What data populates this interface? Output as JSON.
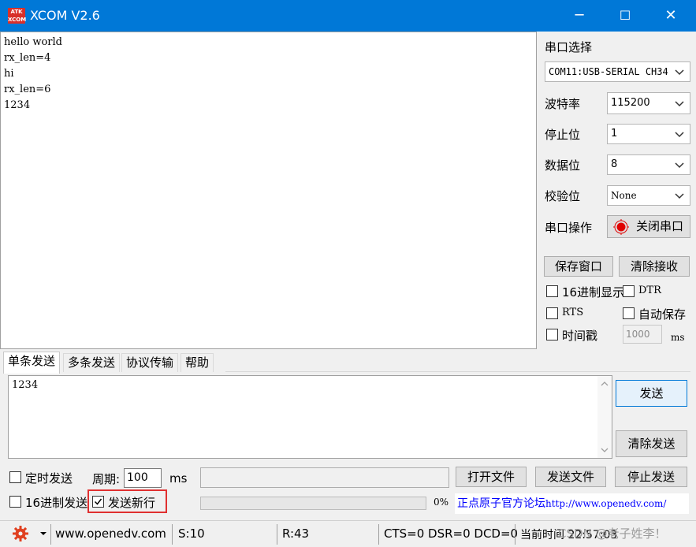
{
  "window": {
    "title": "XCOM V2.6",
    "logo_text": "ATK\nXCOM",
    "minimize": "─",
    "maximize": "☐",
    "close": "✕"
  },
  "receive": {
    "text": "hello world\nrx_len=4\nhi\nrx_len=6\n1234"
  },
  "serial": {
    "section_label": "串口选择",
    "port": "COM11:USB-SERIAL CH34",
    "baud_label": "波特率",
    "baud": "115200",
    "stop_label": "停止位",
    "stop": "1",
    "data_label": "数据位",
    "data": "8",
    "parity_label": "校验位",
    "parity": "None",
    "op_label": "串口操作",
    "op_button": "关闭串口",
    "status_color": "#e00000"
  },
  "recv_controls": {
    "save_window": "保存窗口",
    "clear_recv": "清除接收",
    "hex_display": "16进制显示",
    "dtr": "DTR",
    "rts": "RTS",
    "auto_save": "自动保存",
    "timestamp": "时间戳",
    "timestamp_value": "1000",
    "timestamp_unit": "ms"
  },
  "tabs": [
    "单条发送",
    "多条发送",
    "协议传输",
    "帮助"
  ],
  "send": {
    "text": "1234",
    "send_button": "发送",
    "clear_send": "清除发送",
    "timed_send": "定时发送",
    "period_label": "周期:",
    "period_value": "100",
    "period_unit": "ms",
    "open_file": "打开文件",
    "send_file": "发送文件",
    "stop_send": "停止发送",
    "hex_send": "16进制发送",
    "send_newline": "发送新行",
    "send_newline_checked": true,
    "progress": "0%",
    "forum_link_label": "正点原子官方论坛",
    "forum_url": "http://www.openedv.com/"
  },
  "status": {
    "site": "www.openedv.com",
    "sent": "S:10",
    "received": "R:43",
    "signals": "CTS=0 DSR=0 DCD=0",
    "time": "当前时间 22:57:03",
    "watermark": "CSDN @老子姓李！"
  }
}
